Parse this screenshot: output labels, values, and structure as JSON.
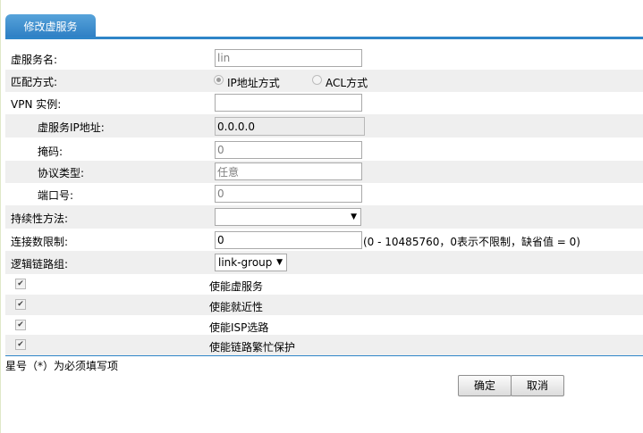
{
  "tab_title": "修改虚服务",
  "form": {
    "vs_name": {
      "label": "虚服务名:",
      "value": "lin"
    },
    "match_mode": {
      "label": "匹配方式:",
      "options": [
        {
          "label": "IP地址方式",
          "selected": true
        },
        {
          "label": "ACL方式",
          "selected": false
        }
      ]
    },
    "vpn_instance": {
      "label": "VPN 实例:",
      "value": ""
    },
    "vs_ip": {
      "label": "虚服务IP地址:",
      "value": "0.0.0.0"
    },
    "mask": {
      "label": "掩码:",
      "value": "0"
    },
    "protocol_type": {
      "label": "协议类型:",
      "value": "任意"
    },
    "port": {
      "label": "端口号:",
      "value": "0"
    },
    "persistence": {
      "label": "持续性方法:",
      "value": ""
    },
    "conn_limit": {
      "label": "连接数限制:",
      "value": "0",
      "hint": "(0 - 10485760，0表示不限制，缺省值 = 0)"
    },
    "link_group": {
      "label": "逻辑链路组:",
      "value": "link-group"
    }
  },
  "checkboxes": [
    {
      "label": "使能虚服务",
      "checked": true
    },
    {
      "label": "使能就近性",
      "checked": true
    },
    {
      "label": "使能ISP选路",
      "checked": true
    },
    {
      "label": "使能链路繁忙保护",
      "checked": true
    }
  ],
  "footer_note": "星号（*）为必须填写项",
  "buttons": {
    "ok": "确定",
    "cancel": "取消"
  },
  "colors": {
    "accent": "#2f85c8",
    "tab_bg": "#3f8fd0",
    "row_alt": "#efefef"
  }
}
